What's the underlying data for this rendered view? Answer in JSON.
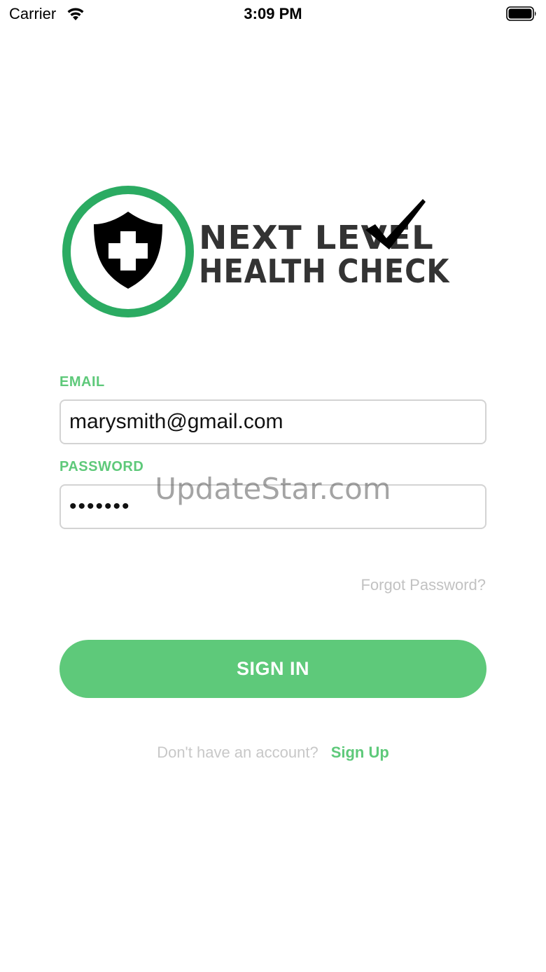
{
  "status_bar": {
    "carrier": "Carrier",
    "time": "3:09 PM",
    "icons": [
      "wifi-icon",
      "battery-icon"
    ]
  },
  "logo": {
    "line1": "NEXT LEVEL",
    "line2": "HEALTH CHECK",
    "ring_color": "#2bab62",
    "shield_color": "#000000",
    "text_color": "#333333"
  },
  "form": {
    "email_label": "EMAIL",
    "email_value": "marysmith@gmail.com",
    "password_label": "PASSWORD",
    "password_value": "•••••••",
    "forgot_password": "Forgot Password?",
    "sign_in_label": "SIGN IN"
  },
  "signup": {
    "prompt": "Don't have an account?",
    "link": "Sign Up"
  },
  "watermark": "UpdateStar.com",
  "colors": {
    "accent": "#5ec97a",
    "muted_text": "#c2c2c2",
    "field_border": "#d3d3d3"
  }
}
